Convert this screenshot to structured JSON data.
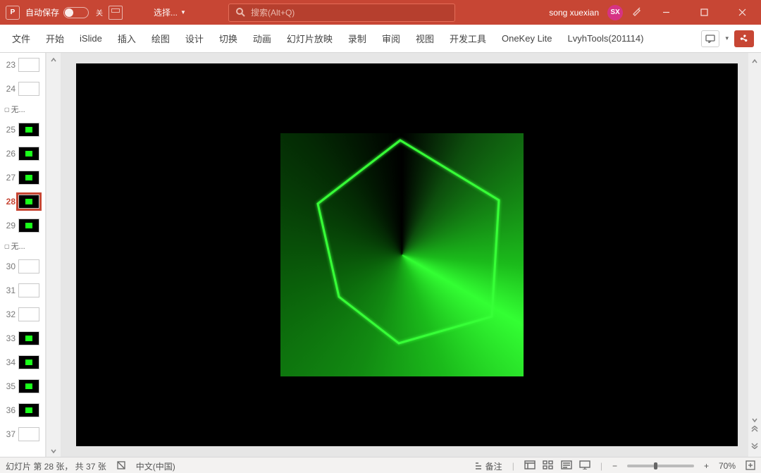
{
  "titlebar": {
    "autosave_label": "自动保存",
    "autosave_state": "关",
    "qat_dropdown": "选择...",
    "search_placeholder": "搜索(Alt+Q)",
    "user_name": "song xuexian",
    "user_initials": "SX"
  },
  "ribbon": {
    "tabs": [
      "文件",
      "开始",
      "iSlide",
      "插入",
      "绘图",
      "设计",
      "切换",
      "动画",
      "幻灯片放映",
      "录制",
      "审阅",
      "视图",
      "开发工具",
      "OneKey Lite",
      "LvyhTools(201114)"
    ]
  },
  "thumbnails": {
    "sections": [
      "无...",
      "无..."
    ],
    "selected_index": 28,
    "slides_a": [
      23,
      24
    ],
    "slides_b": [
      25,
      26,
      27,
      28,
      29
    ],
    "slides_c": [
      30,
      31,
      32,
      33,
      34,
      35,
      36,
      37
    ]
  },
  "status": {
    "slide_info": "幻灯片 第 28 张， 共 37 张",
    "accessibility_tip": "",
    "language": "中文(中国)",
    "notes": "备注",
    "zoom": "70%"
  }
}
